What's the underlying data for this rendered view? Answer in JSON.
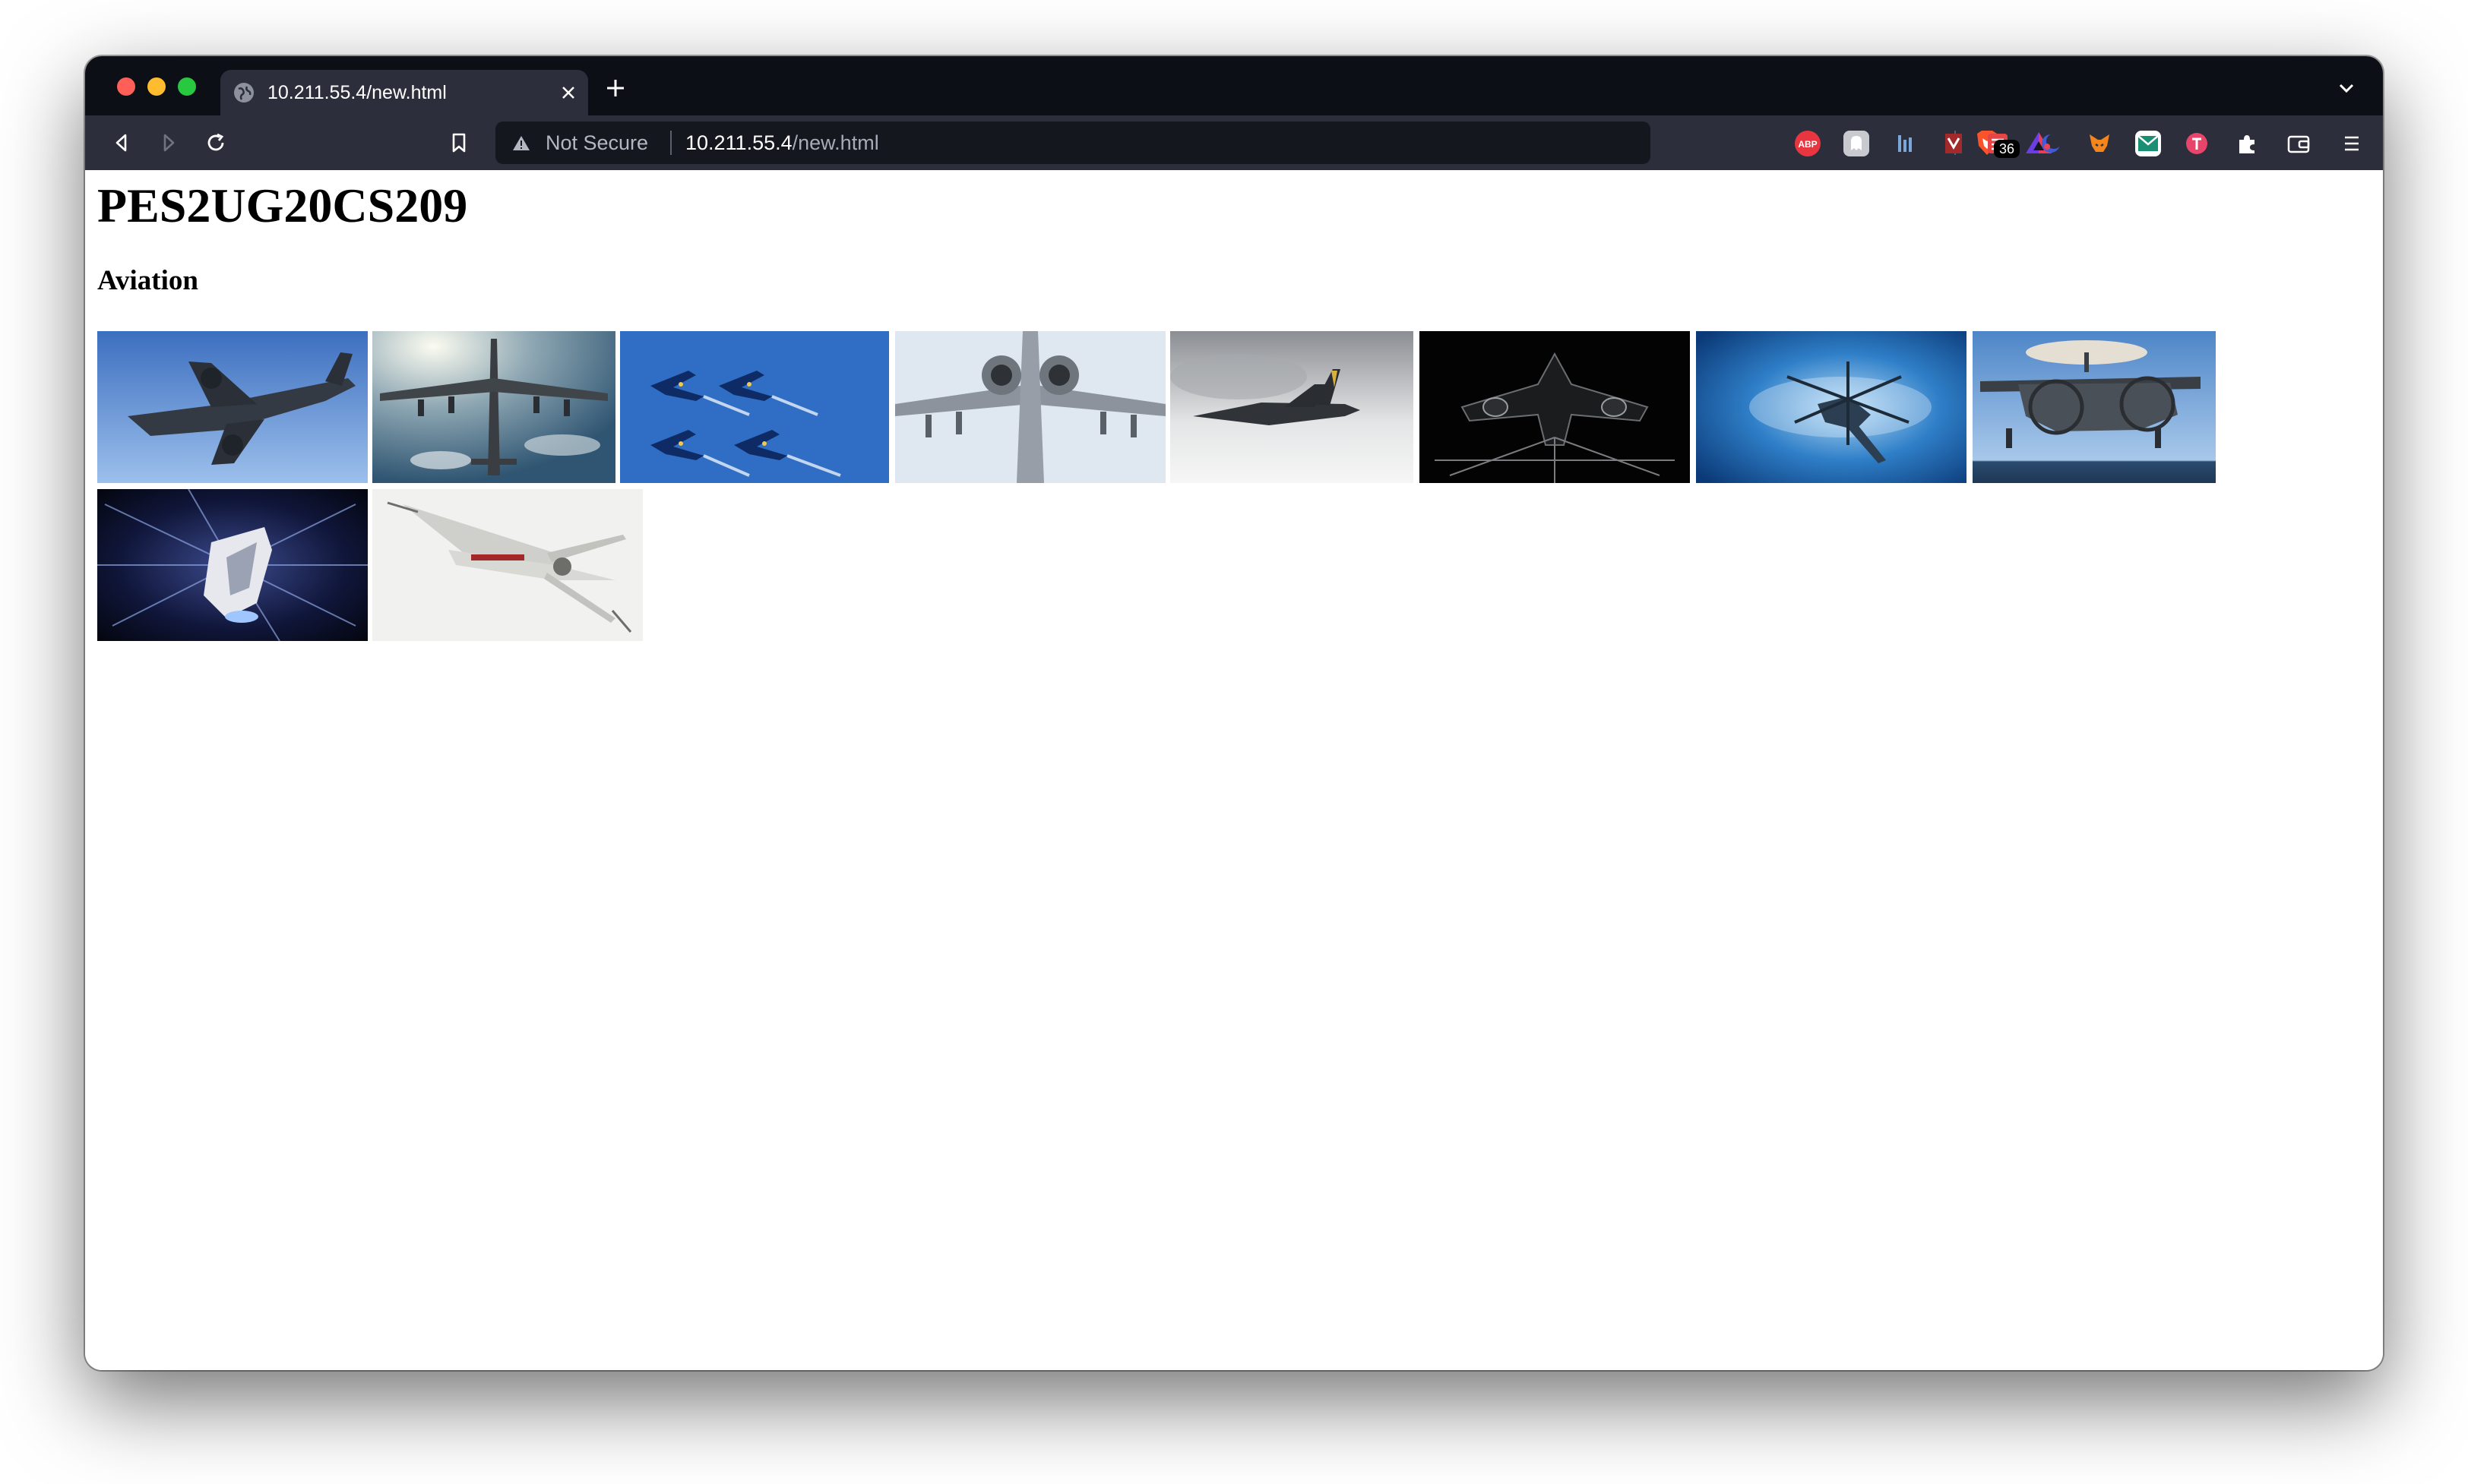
{
  "browser": {
    "tab_title": "10.211.55.4/new.html",
    "security_label": "Not Secure",
    "url_host": "10.211.55.4",
    "url_path": "/new.html",
    "extension_badge_count": "36",
    "theme_colors": {
      "tabstrip": "#0d0f16",
      "toolbar": "#2c2f3b",
      "omnibox": "#15171f"
    }
  },
  "page": {
    "title": "PES2UG20CS209",
    "section_heading": "Aviation"
  },
  "gallery": {
    "images": [
      {
        "subject": "military-transport-aircraft"
      },
      {
        "subject": "b52-bomber-overhead"
      },
      {
        "subject": "blue-angels-formation"
      },
      {
        "subject": "a10-warthog"
      },
      {
        "subject": "f35-fighter-in-clouds"
      },
      {
        "subject": "sr71-blackbird"
      },
      {
        "subject": "helicopter-blue-sky"
      },
      {
        "subject": "e2-hawkeye"
      },
      {
        "subject": "starship-hyperspace"
      },
      {
        "subject": "x-wing-fighter"
      }
    ]
  }
}
